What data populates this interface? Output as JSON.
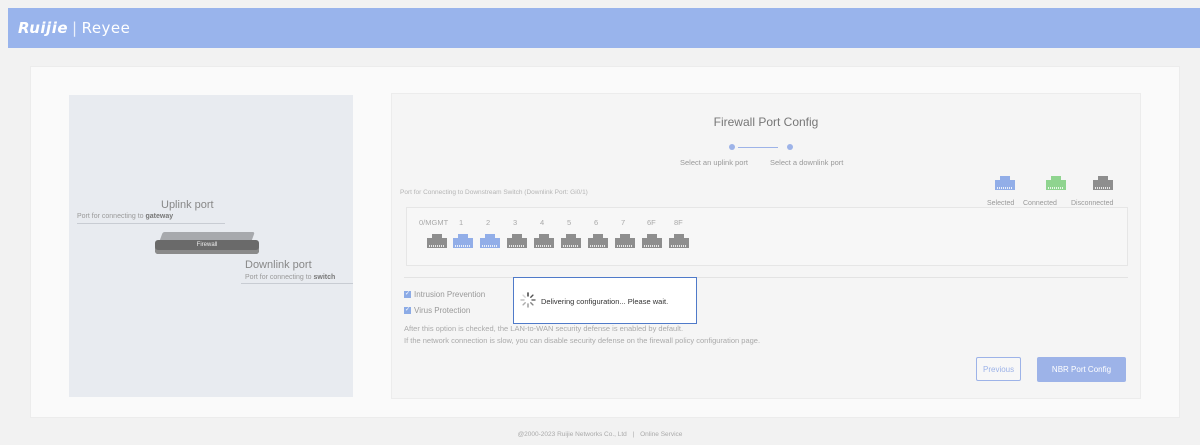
{
  "header": {
    "brand": "Ruijie",
    "separator": "|",
    "sub_brand": "Reyee"
  },
  "diagram": {
    "uplink_title": "Uplink port",
    "uplink_desc": "Port for connecting to",
    "uplink_desc_bold": "gateway",
    "device_label": "Firewall",
    "downlink_title": "Downlink port",
    "downlink_desc": "Port for connecting to",
    "downlink_desc_bold": "switch"
  },
  "config": {
    "title": "Firewall Port Config",
    "steps": [
      "Select an uplink port",
      "Select a downlink port"
    ],
    "ports_subtitle": "Port for Connecting to Downstream Switch (Downlink Port: Gi0/1)",
    "legend": [
      {
        "label": "Selected",
        "state": "blue"
      },
      {
        "label": "Connected",
        "state": "green"
      },
      {
        "label": "Disconnected",
        "state": "gray"
      }
    ],
    "ports": [
      {
        "label": "0/MGMT",
        "state": "gray"
      },
      {
        "label": "1",
        "state": "blue"
      },
      {
        "label": "2",
        "state": "blue"
      },
      {
        "label": "3",
        "state": "gray"
      },
      {
        "label": "4",
        "state": "gray"
      },
      {
        "label": "5",
        "state": "gray"
      },
      {
        "label": "6",
        "state": "gray"
      },
      {
        "label": "7",
        "state": "gray"
      },
      {
        "label": "6F",
        "state": "gray"
      },
      {
        "label": "8F",
        "state": "gray"
      }
    ],
    "options": [
      {
        "label": "Intrusion Prevention",
        "checked": true
      },
      {
        "label": "Virus Protection",
        "checked": true
      }
    ],
    "note_1": "After this option is checked, the LAN-to-WAN security defense is enabled by default.",
    "note_2": "If the network connection is slow, you can disable security defense on the firewall policy configuration page.",
    "previous_button": "Previous",
    "next_button": "NBR Port Config"
  },
  "modal": {
    "message": "Delivering configuration... Please wait."
  },
  "footer": {
    "copyright": "@2000-2023 Ruijie Networks Co., Ltd",
    "separator": "|",
    "link": "Online Service"
  },
  "colors": {
    "accent": "#9db3e8",
    "header_bg": "#99b4ec",
    "port_selected": "#92aee8",
    "port_connected": "#8fd48f",
    "port_disconnected": "#8e8e8e"
  }
}
